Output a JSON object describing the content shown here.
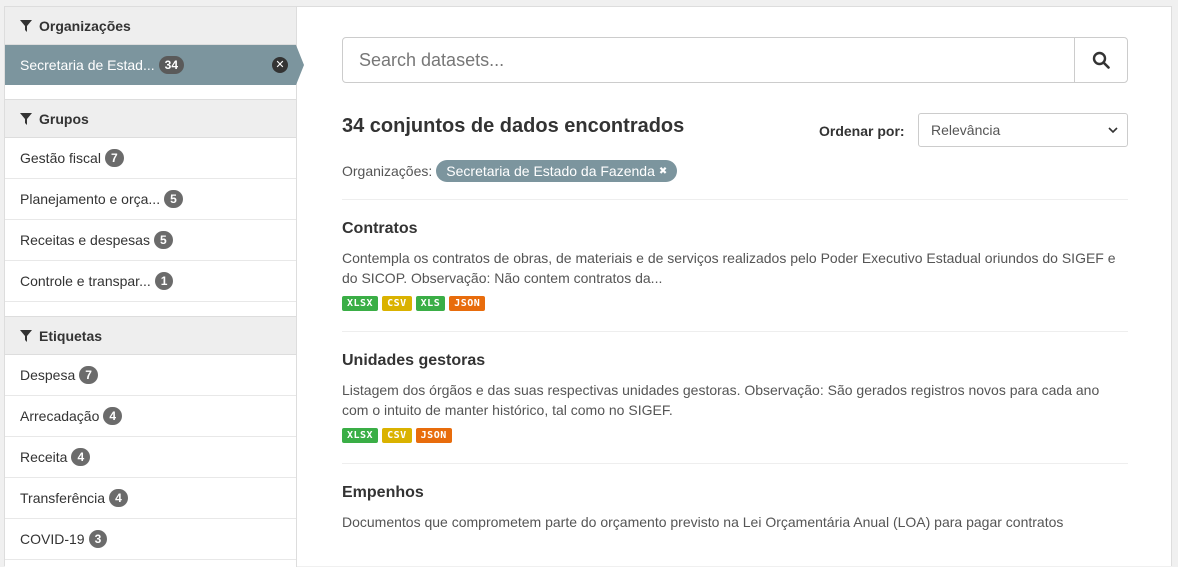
{
  "sidebar": {
    "organizations": {
      "heading": "Organizações",
      "active": {
        "label": "Secretaria de Estad...",
        "count": "34",
        "remove": "✕"
      }
    },
    "groups": {
      "heading": "Grupos",
      "items": [
        {
          "label": "Gestão fiscal",
          "count": "7"
        },
        {
          "label": "Planejamento e orça...",
          "count": "5"
        },
        {
          "label": "Receitas e despesas",
          "count": "5"
        },
        {
          "label": "Controle e transpar...",
          "count": "1"
        }
      ]
    },
    "tags": {
      "heading": "Etiquetas",
      "items": [
        {
          "label": "Despesa",
          "count": "7"
        },
        {
          "label": "Arrecadação",
          "count": "4"
        },
        {
          "label": "Receita",
          "count": "4"
        },
        {
          "label": "Transferência",
          "count": "4"
        },
        {
          "label": "COVID-19",
          "count": "3"
        }
      ]
    }
  },
  "search": {
    "placeholder": "Search datasets..."
  },
  "results": {
    "title": "34 conjuntos de dados encontrados",
    "order_label": "Ordenar por:",
    "order_value": "Relevância",
    "filter_label": "Organizações:",
    "filter_pill": "Secretaria de Estado da Fazenda"
  },
  "datasets": [
    {
      "title": "Contratos",
      "description": "Contempla os contratos de obras, de materiais e de serviços realizados pelo Poder Executivo Estadual oriundos do SIGEF e do SICOP. Observação: Não contem contratos da...",
      "formats": [
        "XLSX",
        "CSV",
        "XLS",
        "JSON"
      ]
    },
    {
      "title": "Unidades gestoras",
      "description": "Listagem dos órgãos e das suas respectivas unidades gestoras. Observação: São gerados registros novos para cada ano com o intuito de manter histórico, tal como no SIGEF.",
      "formats": [
        "XLSX",
        "CSV",
        "JSON"
      ]
    },
    {
      "title": "Empenhos",
      "description": "Documentos que comprometem parte do orçamento previsto na Lei Orçamentária Anual (LOA) para pagar contratos",
      "formats": []
    }
  ],
  "colors": {
    "accent": "#7c959e",
    "green": "#3aae46",
    "yellow": "#dab200",
    "orange": "#e86c0c"
  },
  "icons": {
    "filter": "funnel-icon",
    "search": "magnifier-icon",
    "remove": "close-icon",
    "dropdown": "chevron-down-icon"
  }
}
